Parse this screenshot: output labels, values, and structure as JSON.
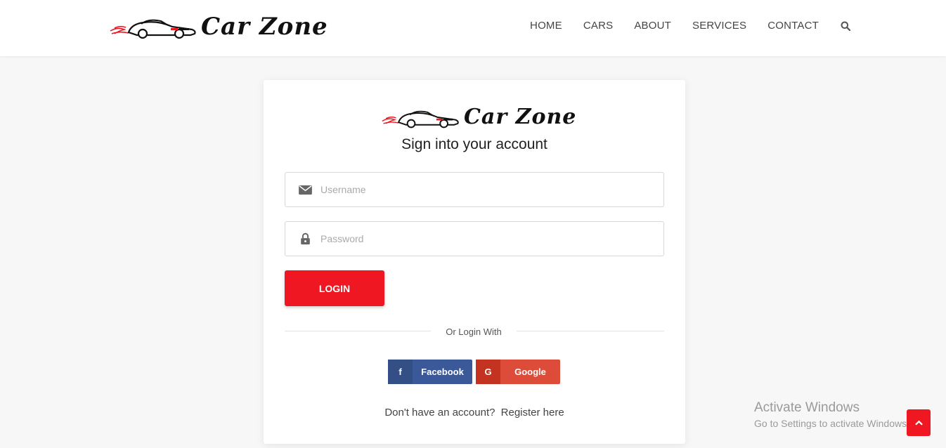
{
  "brand": {
    "name": "Car Zone",
    "accent": "#ef1721"
  },
  "nav": {
    "items": [
      "HOME",
      "CARS",
      "ABOUT",
      "SERVICES",
      "CONTACT"
    ],
    "search_icon": "search-icon"
  },
  "login_card": {
    "title": "Sign into your account",
    "username": {
      "placeholder": "Username",
      "value": "",
      "icon": "envelope-icon"
    },
    "password": {
      "placeholder": "Password",
      "value": "",
      "icon": "lock-icon"
    },
    "login_label": "LOGIN",
    "divider_text": "Or Login With",
    "social": {
      "facebook": {
        "icon_glyph": "f",
        "label": "Facebook",
        "color": "#3b5998"
      },
      "google": {
        "icon_glyph": "G",
        "label": "Google",
        "color": "#dd4b39"
      }
    },
    "register_prompt": "Don't have an account?",
    "register_link": "Register here"
  },
  "watermark": {
    "title": "Activate Windows",
    "subtitle": "Go to Settings to activate Windows."
  },
  "scroll_top_icon": "chevron-up-icon"
}
